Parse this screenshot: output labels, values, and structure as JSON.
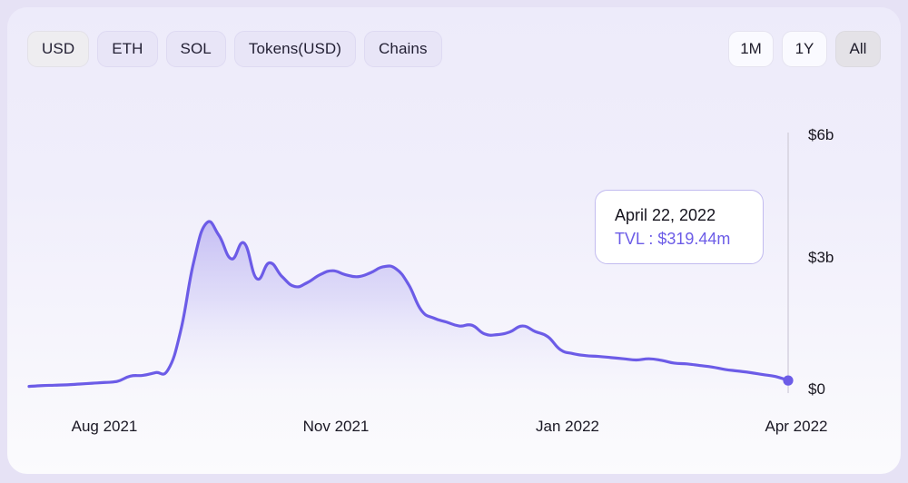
{
  "toolbar": {
    "denomination_buttons": [
      {
        "label": "USD",
        "selected": true
      },
      {
        "label": "ETH",
        "selected": false
      },
      {
        "label": "SOL",
        "selected": false
      },
      {
        "label": "Tokens(USD)",
        "selected": false
      },
      {
        "label": "Chains",
        "selected": false
      }
    ],
    "range_buttons": [
      {
        "label": "1M",
        "selected": false
      },
      {
        "label": "1Y",
        "selected": false
      },
      {
        "label": "All",
        "selected": true
      }
    ]
  },
  "tooltip": {
    "date": "April 22, 2022",
    "value_line": "TVL : $319.44m",
    "metric_name": "TVL",
    "value": "$319.44m"
  },
  "colors": {
    "line": "#6c5ce7",
    "fill_top": "#c9c3f4",
    "fill_bottom": "#f7f6fd",
    "accent_text": "#6c5ce7",
    "axis_line": "#d9d6e2",
    "page_background": "#e6e2f5",
    "card_background": "#efedfb",
    "chip_background": "#e8e5f7",
    "chip_selected_background": "#eeedf0"
  },
  "chart_data": {
    "type": "area",
    "title": "",
    "subtitle": "",
    "xlabel": "",
    "ylabel": "",
    "grid": false,
    "legend_position": "none",
    "y_axis": {
      "ticks": [
        "$0",
        "$3b",
        "$6b"
      ],
      "tick_values": [
        0,
        3000000000,
        6000000000
      ],
      "ylim": [
        0,
        6600000000
      ],
      "position": "right"
    },
    "x_axis": {
      "ticks": [
        "Aug 2021",
        "Nov 2021",
        "Jan 2022",
        "Apr 2022"
      ],
      "xlim": [
        "Jul 2021",
        "Apr 2022"
      ]
    },
    "highlight_point": {
      "x": "April 22, 2022",
      "label": "TVL : $319.44m",
      "value": 319440000
    },
    "series": [
      {
        "name": "TVL",
        "units": "USD",
        "color": "#6c5ce7",
        "x": [
          "2021-07-10",
          "2021-07-17",
          "2021-07-24",
          "2021-07-31",
          "2021-08-07",
          "2021-08-14",
          "2021-08-21",
          "2021-08-28",
          "2021-09-04",
          "2021-09-08",
          "2021-09-11",
          "2021-09-14",
          "2021-09-16",
          "2021-09-18",
          "2021-09-20",
          "2021-09-22",
          "2021-09-24",
          "2021-09-26",
          "2021-09-28",
          "2021-09-30",
          "2021-10-03",
          "2021-10-06",
          "2021-10-09",
          "2021-10-12",
          "2021-10-15",
          "2021-10-18",
          "2021-10-21",
          "2021-10-24",
          "2021-10-27",
          "2021-10-30",
          "2021-11-02",
          "2021-11-06",
          "2021-11-10",
          "2021-11-14",
          "2021-11-18",
          "2021-11-22",
          "2021-11-26",
          "2021-11-30",
          "2021-12-05",
          "2021-12-10",
          "2021-12-15",
          "2021-12-20",
          "2021-12-25",
          "2021-12-31",
          "2022-01-06",
          "2022-01-12",
          "2022-01-18",
          "2022-01-24",
          "2022-01-30",
          "2022-02-06",
          "2022-02-13",
          "2022-02-20",
          "2022-02-27",
          "2022-03-06",
          "2022-03-13",
          "2022-03-20",
          "2022-03-27",
          "2022-04-03",
          "2022-04-10",
          "2022-04-16",
          "2022-04-22"
        ],
        "values": [
          170000000,
          190000000,
          200000000,
          210000000,
          230000000,
          250000000,
          270000000,
          300000000,
          430000000,
          450000000,
          520000000,
          600000000,
          1600000000,
          3300000000,
          4300000000,
          4000000000,
          3400000000,
          3800000000,
          2900000000,
          3300000000,
          2950000000,
          2700000000,
          2800000000,
          3000000000,
          3100000000,
          3000000000,
          2950000000,
          3050000000,
          3200000000,
          3150000000,
          2750000000,
          2100000000,
          1900000000,
          1800000000,
          1700000000,
          1720000000,
          1500000000,
          1480000000,
          1550000000,
          1700000000,
          1560000000,
          1430000000,
          1100000000,
          1000000000,
          950000000,
          930000000,
          900000000,
          870000000,
          840000000,
          870000000,
          830000000,
          760000000,
          740000000,
          700000000,
          660000000,
          600000000,
          560000000,
          520000000,
          470000000,
          420000000,
          319440000
        ]
      }
    ]
  }
}
